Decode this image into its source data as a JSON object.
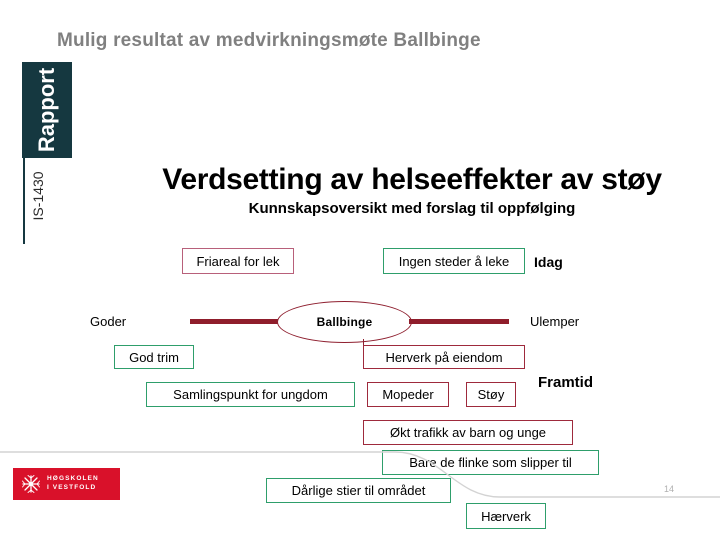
{
  "slide": {
    "title": "Mulig resultat av medvirkningsmøte Ballbinge",
    "page_number": "14"
  },
  "report_cover": {
    "spine_label": "Rapport",
    "code": "IS-1430",
    "title": "Verdsetting av helseeffekter av støy",
    "subtitle": "Kunnskapsoversikt med forslag til oppfølging"
  },
  "mindmap": {
    "center": "Ballbinge",
    "left_axis_label": "Goder",
    "right_axis_label": "Ulemper",
    "time_now_label": "Idag",
    "time_future_label": "Framtid",
    "now_row": [
      {
        "text": "Friareal for lek",
        "side": "good",
        "tone": "pink"
      },
      {
        "text": "Ingen steder å leke",
        "side": "bad",
        "tone": "green"
      }
    ],
    "boxes": [
      {
        "text": "God trim",
        "tone": "green"
      },
      {
        "text": "Herverk på eiendom",
        "tone": "red"
      },
      {
        "text": "Samlingspunkt for ungdom",
        "tone": "green"
      },
      {
        "text": "Mopeder",
        "tone": "red"
      },
      {
        "text": "Støy",
        "tone": "red"
      },
      {
        "text": "Økt trafikk av barn og unge",
        "tone": "red"
      },
      {
        "text": "Bare de flinke som slipper til",
        "tone": "green"
      },
      {
        "text": "Dårlige stier til området",
        "tone": "green"
      },
      {
        "text": "Hærverk",
        "tone": "green"
      }
    ]
  },
  "logo": {
    "line1": "HØGSKOLEN",
    "line2": "I VESTFOLD"
  },
  "colors": {
    "title_gray": "#808080",
    "report_teal": "#153840",
    "accent_red": "#8f1d2b",
    "good_green": "#2e9e6b",
    "bad_red": "#9e2a3c",
    "pink": "#b8607a",
    "logo_red": "#d9112a"
  }
}
